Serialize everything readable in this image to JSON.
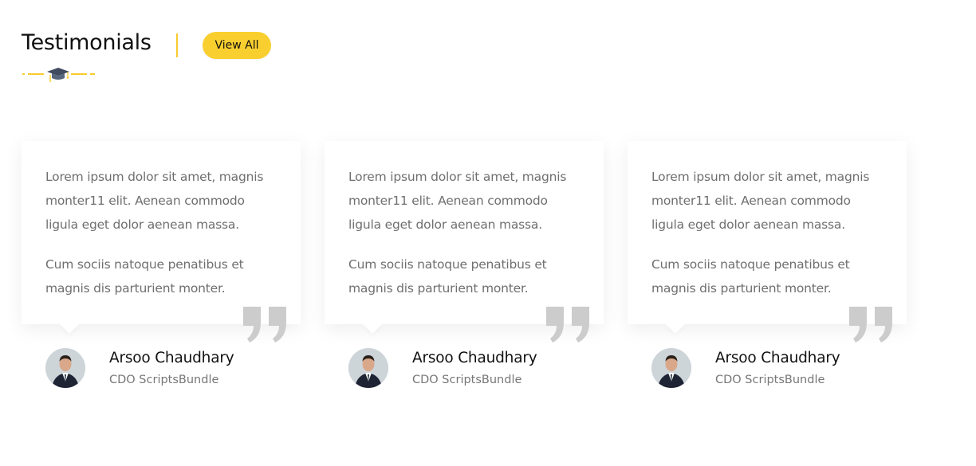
{
  "header": {
    "title": "Testimonials",
    "view_all_label": "View All",
    "ornament_icon": "graduation-cap-icon"
  },
  "colors": {
    "accent": "#f9cf2f",
    "title": "#111111",
    "body_text": "#6f6f6f",
    "quote_icon": "#cccccc"
  },
  "testimonials": [
    {
      "paragraph_1": "Lorem ipsum dolor sit amet, magnis monter11 elit. Aenean commodo ligula eget dolor aenean massa.",
      "paragraph_2": "Cum sociis natoque penatibus et magnis dis parturient monter.",
      "name": "Arsoo Chaudhary",
      "role": "CDO ScriptsBundle",
      "icon": "quote-icon"
    },
    {
      "paragraph_1": "Lorem ipsum dolor sit amet, magnis monter11 elit. Aenean commodo ligula eget dolor aenean massa.",
      "paragraph_2": "Cum sociis natoque penatibus et magnis dis parturient monter.",
      "name": "Arsoo Chaudhary",
      "role": "CDO ScriptsBundle",
      "icon": "quote-icon"
    },
    {
      "paragraph_1": "Lorem ipsum dolor sit amet, magnis monter11 elit. Aenean commodo ligula eget dolor aenean massa.",
      "paragraph_2": "Cum sociis natoque penatibus et magnis dis parturient monter.",
      "name": "Arsoo Chaudhary",
      "role": "CDO ScriptsBundle",
      "icon": "quote-icon"
    }
  ]
}
